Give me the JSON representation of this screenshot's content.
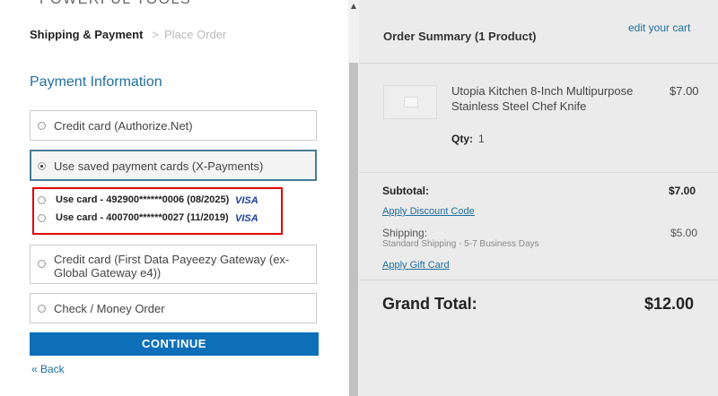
{
  "brand": "POWERFUL TOOLS",
  "checkout_steps": {
    "active": "Shipping & Payment",
    "separator": ">",
    "next": "Place Order"
  },
  "payment": {
    "title": "Payment Information",
    "options": [
      {
        "label": "Credit card (Authorize.Net)",
        "selected": false
      },
      {
        "label": "Use saved payment cards (X-Payments)",
        "selected": true
      },
      {
        "label": "Credit card (First Data Payeezy Gateway (ex-Global Gateway e4))",
        "selected": false
      },
      {
        "label": "Check / Money Order",
        "selected": false
      }
    ],
    "saved_cards": [
      {
        "label": "Use card - 492900******0006 (08/2025)",
        "brand": "VISA"
      },
      {
        "label": "Use card - 400700******0027 (11/2019)",
        "brand": "VISA"
      }
    ],
    "continue_label": "CONTINUE",
    "back_label": "« Back"
  },
  "summary": {
    "title": "Order Summary (1 Product)",
    "edit_cart": "edit your cart",
    "product": {
      "name": "Utopia Kitchen 8-Inch Multipurpose Stainless Steel Chef Knife",
      "price": "$7.00",
      "qty_label": "Qty:",
      "qty": "1"
    },
    "subtotal_label": "Subtotal:",
    "subtotal": "$7.00",
    "discount_link": "Apply Discount Code",
    "shipping_label": "Shipping:",
    "shipping": "$5.00",
    "shipping_method": "Standard Shipping - 5-7 Business Days",
    "gift_card_link": "Apply Gift Card",
    "grand_total_label": "Grand Total:",
    "grand_total": "$12.00"
  },
  "colors": {
    "accent": "#0d6fb8",
    "link": "#1f6f9f",
    "highlight_border": "#e00000",
    "summary_bg": "#ebebeb"
  }
}
